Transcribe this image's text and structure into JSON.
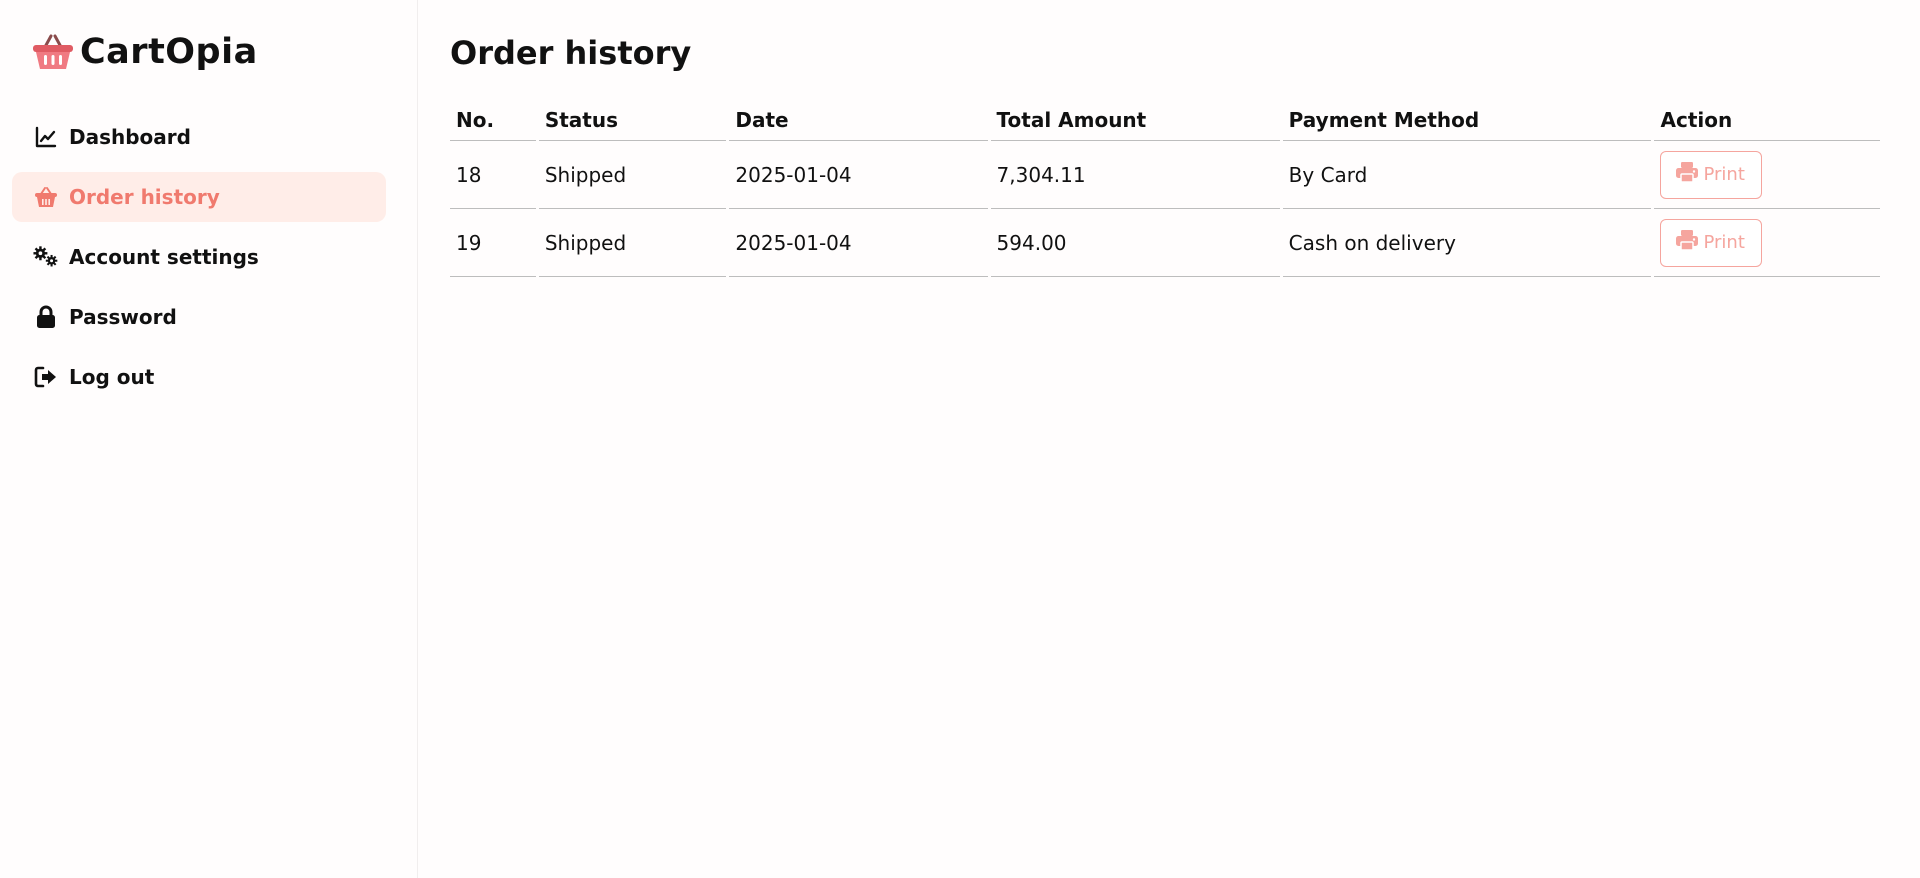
{
  "brand": {
    "name": "CartOpia",
    "logo_icon": "basket-icon",
    "accent_color": "#f07a6e"
  },
  "sidebar": {
    "items": [
      {
        "label": "Dashboard",
        "icon": "line-chart-icon",
        "active": false
      },
      {
        "label": "Order history",
        "icon": "basket-icon",
        "active": true
      },
      {
        "label": "Account settings",
        "icon": "gears-icon",
        "active": false
      },
      {
        "label": "Password",
        "icon": "lock-icon",
        "active": false
      },
      {
        "label": "Log out",
        "icon": "logout-icon",
        "active": false
      }
    ]
  },
  "main": {
    "title": "Order history",
    "table": {
      "headers": [
        "No.",
        "Status",
        "Date",
        "Total Amount",
        "Payment Method",
        "Action"
      ],
      "rows": [
        {
          "no": "18",
          "status": "Shipped",
          "date": "2025-01-04",
          "total": "7,304.11",
          "payment": "By Card",
          "action": "Print"
        },
        {
          "no": "19",
          "status": "Shipped",
          "date": "2025-01-04",
          "total": "594.00",
          "payment": "Cash on delivery",
          "action": "Print"
        }
      ],
      "action_icon": "printer-icon"
    }
  }
}
